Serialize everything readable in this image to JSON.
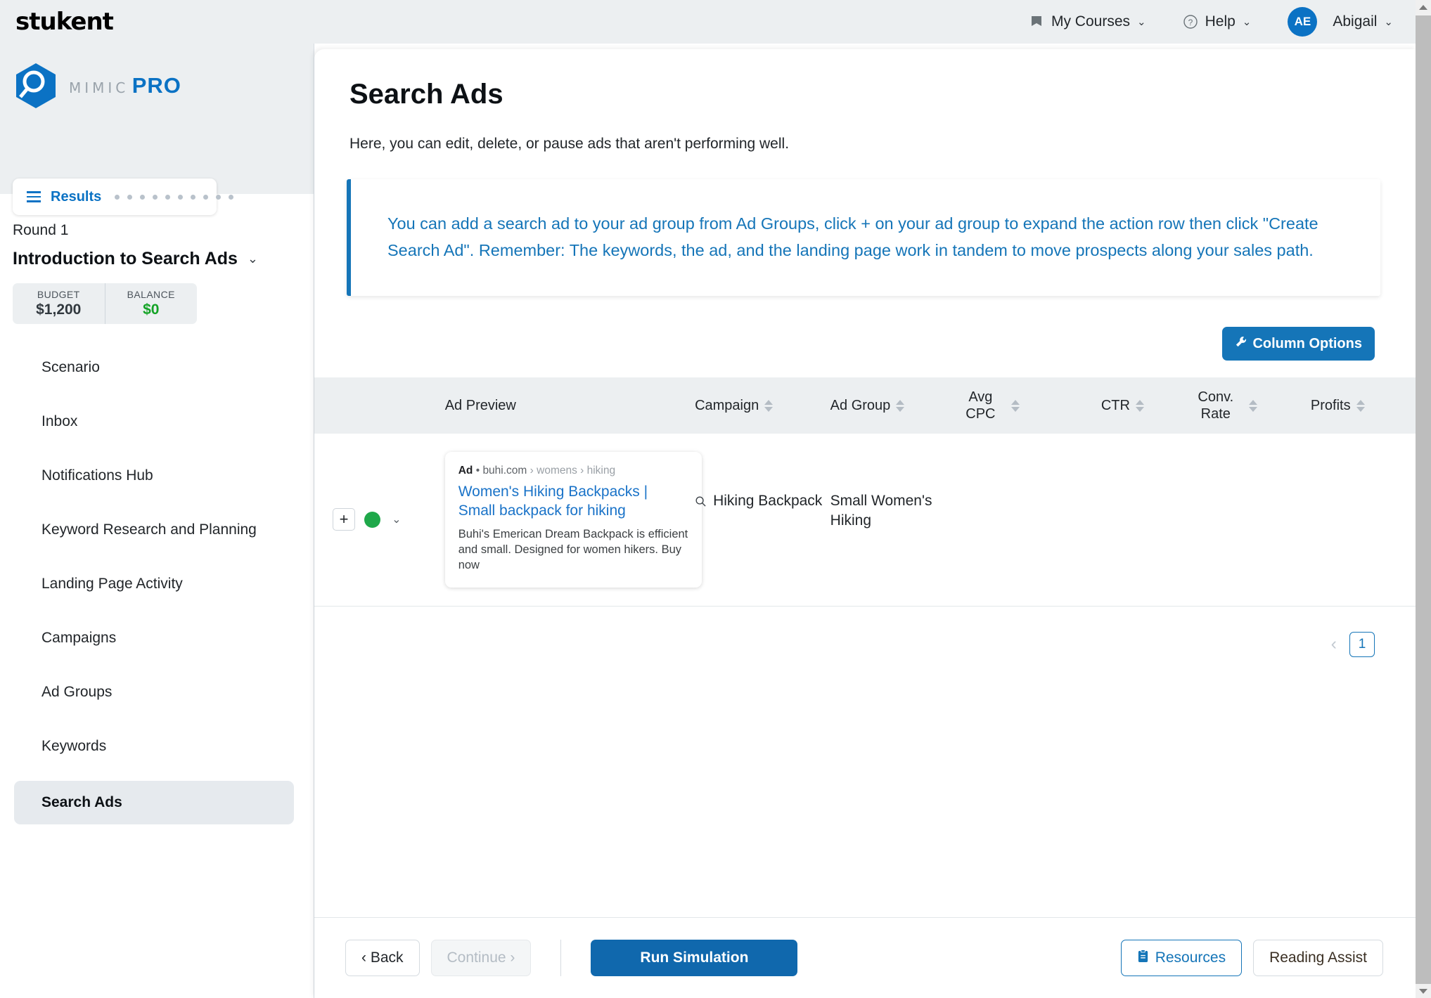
{
  "topbar": {
    "brand": "stukent",
    "my_courses": "My Courses",
    "help": "Help",
    "user_initials": "AE",
    "user_name": "Abigail",
    "caret": "⌄"
  },
  "sidebar": {
    "product_line1": "MIMIC",
    "product_line2": "PRO",
    "results_label": "Results",
    "progress_dots": 10,
    "round_label": "Round 1",
    "round_title": "Introduction to Search Ads",
    "budget_label": "BUDGET",
    "budget_value": "$1,200",
    "balance_label": "BALANCE",
    "balance_value": "$0",
    "items": [
      {
        "label": "Scenario",
        "active": false
      },
      {
        "label": "Inbox",
        "active": false
      },
      {
        "label": "Notifications Hub",
        "active": false
      },
      {
        "label": "Keyword Research and Planning",
        "active": false
      },
      {
        "label": "Landing Page Activity",
        "active": false
      },
      {
        "label": "Campaigns",
        "active": false
      },
      {
        "label": "Ad Groups",
        "active": false
      },
      {
        "label": "Keywords",
        "active": false
      },
      {
        "label": "Search Ads",
        "active": true
      }
    ]
  },
  "main": {
    "title": "Search Ads",
    "subtitle": "Here, you can edit, delete, or pause ads that aren't performing well.",
    "notice": "You can add a search ad to your ad group from Ad Groups, click + on your ad group to expand the action row then click \"Create Search Ad\". Remember: The keywords, the ad, and the landing page work in tandem to move prospects along your sales path.",
    "column_options_label": "Column Options",
    "columns": [
      "Ad Preview",
      "Campaign",
      "Ad Group",
      "Avg CPC",
      "CTR",
      "Conv. Rate",
      "Profits"
    ],
    "rows": [
      {
        "expand": "+",
        "status": "active",
        "ad": {
          "badge": "Ad",
          "separator": "•",
          "domain": "buhi.com",
          "path": "› womens › hiking",
          "headline": "Women's Hiking Backpacks | Small backpack for hiking",
          "description": "Buhi's Emerican Dream Backpack is efficient and small. Designed for women hikers. Buy now"
        },
        "campaign": "Hiking Backpack",
        "ad_group": "Small Women's Hiking",
        "avg_cpc": "",
        "ctr": "",
        "conv_rate": "",
        "profits": ""
      }
    ],
    "pagination": {
      "prev": "‹",
      "current": "1"
    }
  },
  "bottombar": {
    "back": "‹ Back",
    "continue": "Continue ›",
    "run_simulation": "Run Simulation",
    "resources": "Resources",
    "reading_assist": "Reading Assist"
  },
  "colors": {
    "accent_blue": "#1575b8",
    "brand_blue": "#0b72c4",
    "status_green": "#1fa84a",
    "balance_green": "#14a326"
  }
}
